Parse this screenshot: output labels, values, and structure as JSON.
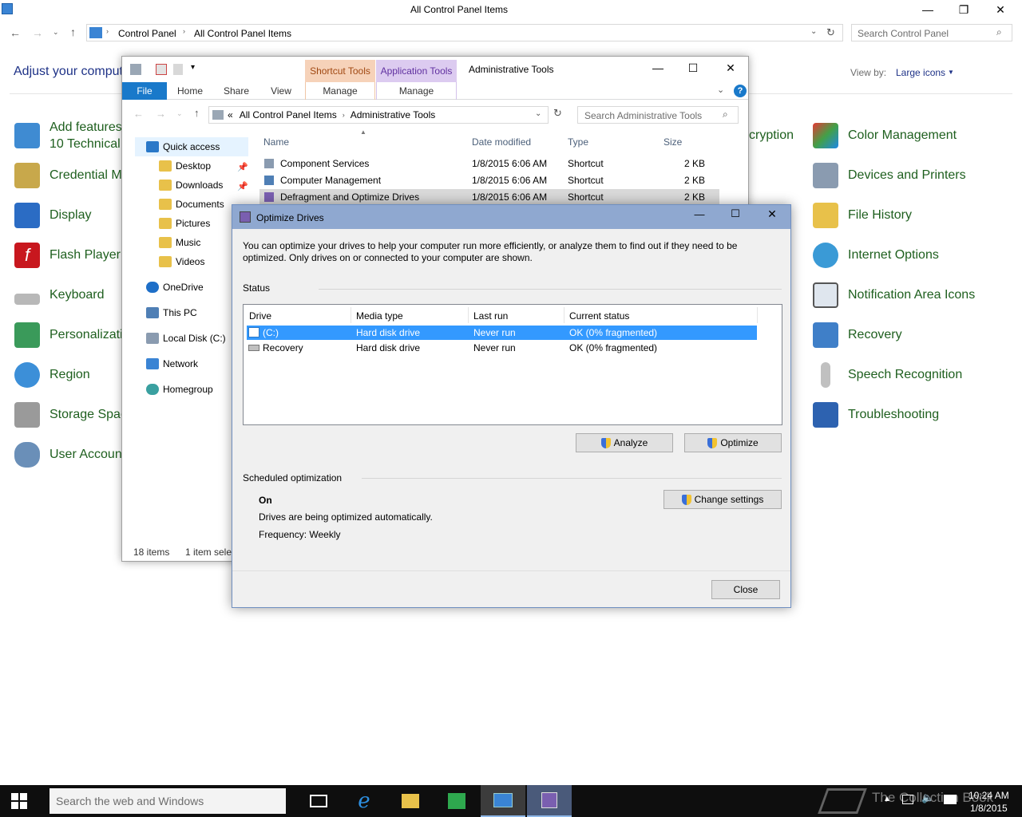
{
  "control_panel": {
    "title": "All Control Panel Items",
    "breadcrumb": [
      "Control Panel",
      "All Control Panel Items"
    ],
    "search_placeholder": "Search Control Panel",
    "heading": "Adjust your comput",
    "view_by_label": "View by:",
    "view_by_value": "Large icons",
    "left_items": [
      "Add features",
      "10 Technical",
      "Credential M",
      "Display",
      "Flash Player",
      "Keyboard",
      "Personalizati",
      "Region",
      "Storage Spac",
      "User Account"
    ],
    "right_items": [
      "Color Management",
      "Devices and Printers",
      "File History",
      "Internet Options",
      "Notification Area Icons",
      "Recovery",
      "Speech Recognition",
      "Troubleshooting"
    ],
    "partial_item": "cryption"
  },
  "explorer": {
    "title": "Administrative Tools",
    "context_tabs": [
      "Shortcut Tools",
      "Application Tools"
    ],
    "ribbon_tabs": [
      "File",
      "Home",
      "Share",
      "View",
      "Manage",
      "Manage"
    ],
    "address_prefix": "«",
    "breadcrumb": [
      "All Control Panel Items",
      "Administrative Tools"
    ],
    "search_placeholder": "Search Administrative Tools",
    "nav": [
      "Quick access",
      "Desktop",
      "Downloads",
      "Documents",
      "Pictures",
      "Music",
      "Videos",
      "OneDrive",
      "This PC",
      "Local Disk (C:)",
      "Network",
      "Homegroup"
    ],
    "columns": [
      "Name",
      "Date modified",
      "Type",
      "Size"
    ],
    "files": [
      {
        "name": "Component Services",
        "date": "1/8/2015 6:06 AM",
        "type": "Shortcut",
        "size": "2 KB"
      },
      {
        "name": "Computer Management",
        "date": "1/8/2015 6:06 AM",
        "type": "Shortcut",
        "size": "2 KB"
      },
      {
        "name": "Defragment and Optimize Drives",
        "date": "1/8/2015 6:06 AM",
        "type": "Shortcut",
        "size": "2 KB"
      }
    ],
    "status_items": "18 items",
    "status_selected": "1 item sele"
  },
  "dialog": {
    "title": "Optimize Drives",
    "description_line1": "You can optimize your drives to help your computer run more efficiently, or analyze them to find out if they need to be",
    "description_line2": "optimized. Only drives on or connected to your computer are shown.",
    "status_label": "Status",
    "columns": [
      "Drive",
      "Media type",
      "Last run",
      "Current status"
    ],
    "drives": [
      {
        "drive": "(C:)",
        "media": "Hard disk drive",
        "last_run": "Never run",
        "status": "OK (0% fragmented)"
      },
      {
        "drive": "Recovery",
        "media": "Hard disk drive",
        "last_run": "Never run",
        "status": "OK (0% fragmented)"
      }
    ],
    "analyze_label": "Analyze",
    "optimize_label": "Optimize",
    "scheduled_label": "Scheduled optimization",
    "schedule_state": "On",
    "schedule_desc": "Drives are being optimized automatically.",
    "frequency": "Frequency: Weekly",
    "change_settings_label": "Change settings",
    "close_label": "Close"
  },
  "taskbar": {
    "search_placeholder": "Search the web and Windows",
    "time": "10:24 AM",
    "date": "1/8/2015",
    "watermark": "The Collection Book"
  },
  "colors": {
    "accent": "#1979ca",
    "link_green": "#1e5f1e",
    "heading_blue": "#1e3287",
    "selection": "#3399ff"
  }
}
